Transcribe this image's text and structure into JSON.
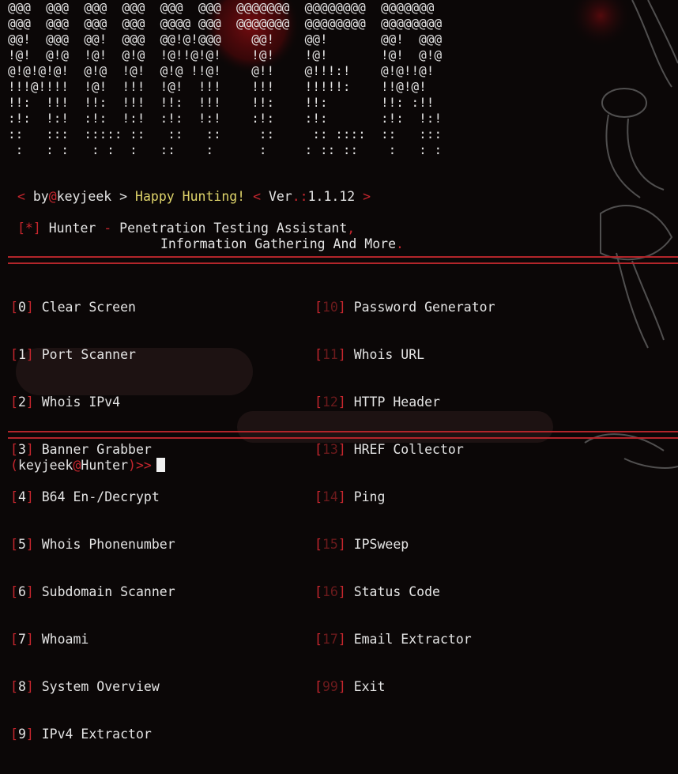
{
  "banner": {
    "ascii_lines": [
      "@@@  @@@  @@@  @@@  @@@  @@@  @@@@@@@  @@@@@@@@  @@@@@@@",
      "@@@  @@@  @@@  @@@  @@@@ @@@  @@@@@@@  @@@@@@@@  @@@@@@@@",
      "@@!  @@@  @@!  @@@  @@!@!@@@    @@!    @@!       @@!  @@@",
      "!@!  @!@  !@!  @!@  !@!!@!@!    !@!    !@!       !@!  @!@",
      "@!@!@!@!  @!@  !@!  @!@ !!@!    @!!    @!!!:!    @!@!!@!",
      "!!!@!!!!  !@!  !!!  !@!  !!!    !!!    !!!!!:    !!@!@!",
      "!!:  !!!  !!:  !!!  !!:  !!!    !!:    !!:       !!: :!!",
      ":!:  !:!  :!:  !:!  :!:  !:!    :!:    :!:       :!:  !:!",
      "::   :::  ::::: ::   ::   ::     ::     :: ::::  ::   :::",
      " :   : :   : :  :   ::    :      :     : :: ::    :   : :"
    ]
  },
  "info": {
    "lt1": "<",
    "by": "by",
    "at": "@",
    "author": "keyjeek",
    "gt1": ">",
    "greeting": "Happy Hunting!",
    "lt2": "<",
    "ver_label": "Ver",
    "ver_sep": ".:",
    "version": "1.1.12",
    "gt2": ">"
  },
  "tagline": {
    "bracket": "[*]",
    "name": "Hunter",
    "dash": "-",
    "line1": "Penetration Testing Assistant",
    "comma": ",",
    "line2": "Information Gathering And More",
    "period": "."
  },
  "menu_left": [
    {
      "num": "0",
      "label": "Clear Screen"
    },
    {
      "num": "1",
      "label": "Port Scanner"
    },
    {
      "num": "2",
      "label": "Whois IPv4"
    },
    {
      "num": "3",
      "label": "Banner Grabber"
    },
    {
      "num": "4",
      "label": "B64 En-/Decrypt"
    },
    {
      "num": "5",
      "label": "Whois Phonenumber"
    },
    {
      "num": "6",
      "label": "Subdomain Scanner"
    },
    {
      "num": "7",
      "label": "Whoami"
    },
    {
      "num": "8",
      "label": "System Overview"
    },
    {
      "num": "9",
      "label": "IPv4 Extractor"
    }
  ],
  "menu_right": [
    {
      "num": "10",
      "label": "Password Generator"
    },
    {
      "num": "11",
      "label": "Whois URL"
    },
    {
      "num": "12",
      "label": "HTTP Header"
    },
    {
      "num": "13",
      "label": "HREF Collector"
    },
    {
      "num": "14",
      "label": "Ping"
    },
    {
      "num": "15",
      "label": "IPSweep"
    },
    {
      "num": "16",
      "label": "Status Code"
    },
    {
      "num": "17",
      "label": "Email Extractor"
    },
    {
      "num": "99",
      "label": "Exit"
    }
  ],
  "prompt": {
    "open": "(",
    "user": "keyjeek",
    "at": "@",
    "host": "Hunter",
    "close": ")",
    "arrows": ">>"
  },
  "colors": {
    "background": "#0b0707",
    "accent_red": "#c6262e",
    "text": "#e4e4e4",
    "yellow": "#ded36a"
  }
}
